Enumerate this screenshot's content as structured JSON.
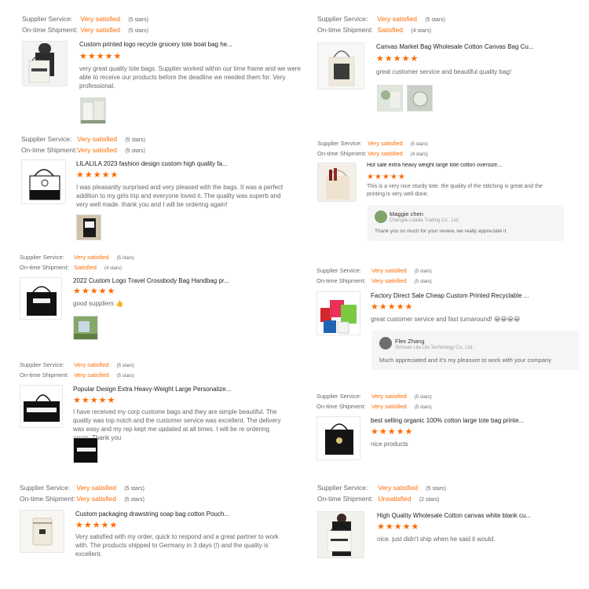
{
  "labels": {
    "supplier_service": "Supplier Service:",
    "on_time_shipment": "On-time Shipment:"
  },
  "reviews": [
    {
      "supplier_service": "Very satisfied",
      "supplier_stars": "(5 stars)",
      "shipment": "Very satisfied",
      "shipment_stars": "(5 stars)",
      "product_title": "Custom printed logo recycle grocery tote boat bag he...",
      "stars": "★★★★★",
      "comment": "very great quality tote bags. Supplier worked within our time frame and we were able to receive our products before the deadline we needed them for. Very professional."
    },
    {
      "supplier_service": "Very satisfied",
      "supplier_stars": "(5 stars)",
      "shipment": "Satisfied",
      "shipment_stars": "(4 stars)",
      "product_title": "Canvas Market Bag Wholesale Cotton Canvas Bag Cu...",
      "stars": "★★★★★",
      "comment": "great customer service and beautiful quality bag!"
    },
    {
      "supplier_service": "Very satisfied",
      "supplier_stars": "(5 stars)",
      "shipment": "Very satisfied",
      "shipment_stars": "(5 stars)",
      "product_title": "LILALILA 2023 fashion design custom high quality fa...",
      "stars": "★★★★★",
      "comment": "I was pleasantly surprised and very pleased with the bags. It was a perfect addition to my girls trip and everyone loved it.  The quality was superb and very well made. thank you and I will be ordering again!"
    },
    {
      "supplier_service": "Very satisfied",
      "supplier_stars": "(5 stars)",
      "shipment": "Very satisfied",
      "shipment_stars": "(4 stars)",
      "product_title": "Hot sale extra heavy weight large tote cotton oversize...",
      "stars": "★★★★★",
      "comment": "This is a very nice sturdy tote. the quality of the stitching is great and the printing is very well done.",
      "reply": {
        "name": "Maggie chen",
        "company": "Chengdu Lilalila Trading Co., Ltd.",
        "text": "Thank you so much for your review, we really appreciate it"
      }
    },
    {
      "supplier_service": "Very satisfied",
      "supplier_stars": "(5 stars)",
      "shipment": "Satisfied",
      "shipment_stars": "(4 stars)",
      "product_title": "2022 Custom Logo Travel Crossbody Bag Handbag pr...",
      "stars": "★★★★★",
      "comment": "good suppliers 👍"
    },
    {
      "supplier_service": "Very satisfied",
      "supplier_stars": "(5 stars)",
      "shipment": "Very satisfied",
      "shipment_stars": "(5 stars)",
      "product_title": "Factory Direct Sale Cheap Custom Printed Recyclable ...",
      "stars": "★★★★★",
      "comment": "great customer service and fast turnaround! 😀😀😀😀",
      "reply": {
        "name": "Flex Zhang",
        "company": "Sichuan Lila Lila Technology Co., Ltd.",
        "text": "Much appreciated and it's my pleasure to work with your company"
      }
    },
    {
      "supplier_service": "Very satisfied",
      "supplier_stars": "(5 stars)",
      "shipment": "Very satisfied",
      "shipment_stars": "(5 stars)",
      "product_title": "Popular Design Extra Heavy-Weight Large Personalize...",
      "stars": "★★★★★",
      "comment": "I have received my corp custome bags and they are simple beautiful. The quality was top notch and the customer service was excellent. The delivery was easy and my rep kept me updated at all times. I will be re ordering again. Thank you"
    },
    {
      "supplier_service": "Very satisfied",
      "supplier_stars": "(5 stars)",
      "shipment": "Very satisfied",
      "shipment_stars": "(5 stars)",
      "product_title": "best selling organic 100% cotton large tote bag printe...",
      "stars": "★★★★★",
      "comment": "nice products"
    },
    {
      "supplier_service": "Very satisfied",
      "supplier_stars": "(5 stars)",
      "shipment": "Very satisfied",
      "shipment_stars": "(5 stars)",
      "product_title": "Custom packaging drawstring soap bag cotton Pouch...",
      "stars": "★★★★★",
      "comment": "Very satisfied with my order, quick to respond and a great partner to work with. The products shipped to Germany in 3 days (!) and the quality is excellent."
    },
    {
      "supplier_service": "Very satisfied",
      "supplier_stars": "(5 stars)",
      "shipment": "Unsatisfied",
      "shipment_stars": "(2 stars)",
      "product_title": "High Quality Wholesale Cotton canvas white blank cu...",
      "stars": "★★★★★",
      "comment": "nice. just didn't ship when he said it would."
    }
  ]
}
